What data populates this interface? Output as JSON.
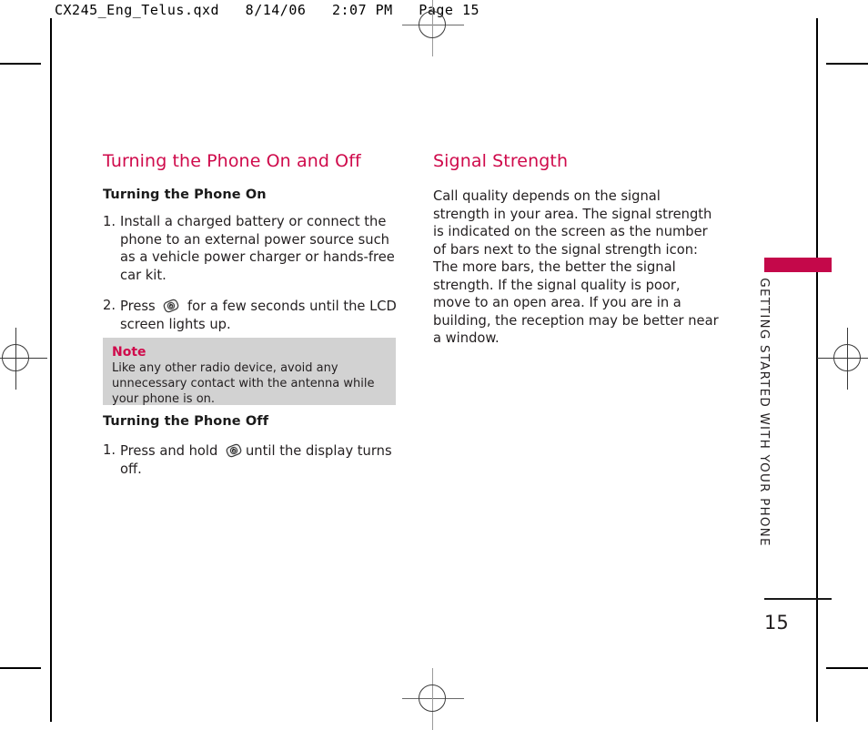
{
  "prepress": {
    "header": "CX245_Eng_Telus.qxd   8/14/06   2:07 PM   Page 15",
    "accent_color": "#cf0a4b",
    "tab_color": "#c4084a",
    "note_bg_color": "#d2d2d2"
  },
  "left_column": {
    "section_title": "Turning the Phone On and Off",
    "on_subtitle": "Turning the Phone On",
    "steps": [
      {
        "number": "1.",
        "text": "Install a charged battery or connect the phone to an external power source such as a vehicle power charger or hands-free car kit."
      },
      {
        "number": "2.",
        "text_before": "Press",
        "icon": "power-key-icon",
        "text_after": "for a few seconds until the LCD screen lights up."
      }
    ],
    "note": {
      "label": "Note",
      "text": "Like any other radio device, avoid any unnecessary contact with the antenna while your phone is on."
    },
    "off_subtitle": "Turning the Phone Off",
    "off_step": {
      "number": "1.",
      "text_before": "Press and hold",
      "icon": "power-key-icon",
      "text_after": "until the display turns off."
    }
  },
  "right_column": {
    "section_title": "Signal Strength",
    "body": "Call quality depends on the signal strength in your area. The signal strength is indicated on the screen as the number of bars next to the signal strength icon: The more bars, the better the signal strength. If the signal quality is poor, move to an open area. If you are in a building, the reception may be better near a window."
  },
  "running_head": {
    "text": "GETTING STARTED WITH YOUR PHONE"
  },
  "folio": {
    "page_number": "15"
  }
}
